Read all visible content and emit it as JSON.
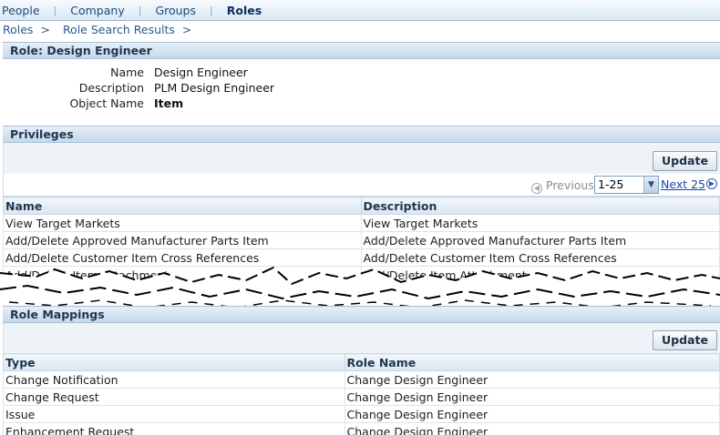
{
  "tabs": [
    {
      "label": "People",
      "active": false
    },
    {
      "label": "Company",
      "active": false
    },
    {
      "label": "Groups",
      "active": false
    },
    {
      "label": "Roles",
      "active": true
    }
  ],
  "breadcrumb": [
    "Roles",
    "Role Search Results"
  ],
  "breadcrumb_separator": ">",
  "role_section": {
    "title": "Role: Design Engineer",
    "fields": [
      {
        "label": "Name",
        "value": "Design Engineer"
      },
      {
        "label": "Description",
        "value": "PLM Design Engineer"
      },
      {
        "label": "Object Name",
        "value": "Item"
      }
    ]
  },
  "privileges": {
    "title": "Privileges",
    "update_label": "Update",
    "pagination": {
      "previous_label": "Previous",
      "range_value": "1-25",
      "next_label": "Next 25"
    },
    "columns": [
      "Name",
      "Description"
    ],
    "rows": [
      [
        "View Target Markets",
        "View Target Markets"
      ],
      [
        "Add/Delete Approved Manufacturer Parts Item",
        "Add/Delete Approved Manufacturer Parts Item"
      ],
      [
        "Add/Delete Customer Item Cross References",
        "Add/Delete Customer Item Cross References"
      ],
      [
        "Add/Delete Item Attachment",
        "Add/Delete Item Attachment"
      ]
    ]
  },
  "role_mappings": {
    "title": "Role Mappings",
    "update_label": "Update",
    "columns": [
      "Type",
      "Role Name"
    ],
    "rows": [
      [
        "Change Notification",
        "Change Design Engineer"
      ],
      [
        "Change Request",
        "Change Design Engineer"
      ],
      [
        "Issue",
        "Change Design Engineer"
      ],
      [
        "Enhancement Request",
        "Change Design Engineer"
      ]
    ]
  },
  "colors": {
    "tab_active": "#0b2f63",
    "link": "#1a47a8",
    "header_bg": "#c6d8e9"
  }
}
